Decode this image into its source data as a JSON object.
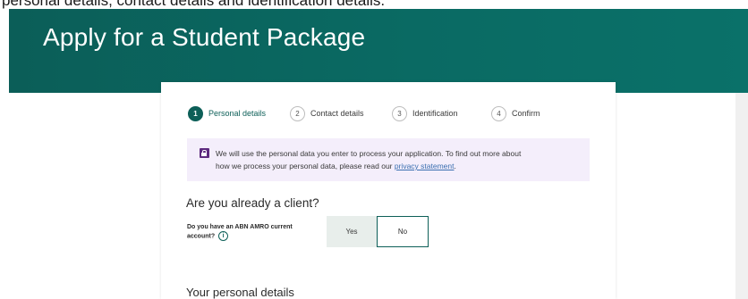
{
  "caption": "personal details, contact details and identification details.",
  "header": {
    "title": "Apply for a Student Package"
  },
  "stepper": {
    "steps": [
      {
        "number": "1",
        "label": "Personal details",
        "active": true
      },
      {
        "number": "2",
        "label": "Contact details",
        "active": false
      },
      {
        "number": "3",
        "label": "Identification",
        "active": false
      },
      {
        "number": "4",
        "label": "Confirm",
        "active": false
      }
    ]
  },
  "notice": {
    "line1": "We will use the personal data you enter to process your application. To find out more about",
    "line2_prefix": "how we process your personal data, please read our ",
    "link": "privacy statement",
    "line2_suffix": "."
  },
  "client": {
    "heading": "Are you already a client?",
    "question": "Do you have an ABN AMRO current account?",
    "info_icon": "i",
    "yes_label": "Yes",
    "no_label": "No",
    "selected": "No"
  },
  "personal": {
    "heading": "Your personal details"
  },
  "colors": {
    "brand": "#0b5e58",
    "notice_bg": "#f4eefb",
    "lock": "#5d2a7e",
    "link": "#3a6fb0"
  }
}
